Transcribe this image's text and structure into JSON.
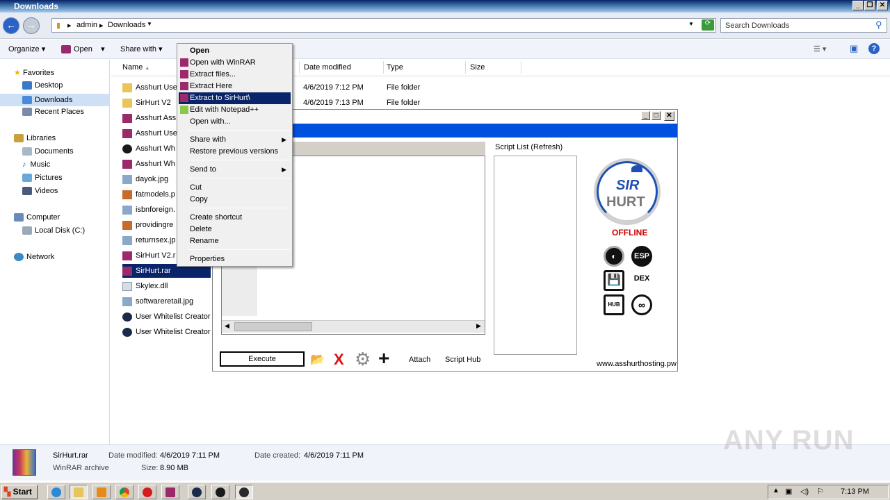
{
  "window": {
    "title": "Downloads"
  },
  "address": {
    "crumbs": [
      "admin",
      "Downloads"
    ],
    "search_placeholder": "Search Downloads"
  },
  "toolbar": {
    "organize": "Organize",
    "open": "Open",
    "share_with": "Share with"
  },
  "nav": {
    "favorites": "Favorites",
    "desktop": "Desktop",
    "downloads": "Downloads",
    "recent": "Recent Places",
    "libraries": "Libraries",
    "documents": "Documents",
    "music": "Music",
    "pictures": "Pictures",
    "videos": "Videos",
    "computer": "Computer",
    "local_disk": "Local Disk (C:)",
    "network": "Network"
  },
  "columns": {
    "name": "Name",
    "date": "Date modified",
    "type": "Type",
    "size": "Size"
  },
  "files": [
    {
      "name": "Asshurt Use",
      "date": "4/6/2019 7:12 PM",
      "type": "File folder"
    },
    {
      "name": "SirHurt V2",
      "date": "4/6/2019 7:13 PM",
      "type": "File folder"
    },
    {
      "name": "Asshurt Ass",
      "date": "",
      "type": ""
    },
    {
      "name": "Asshurt Use",
      "date": "",
      "type": ""
    },
    {
      "name": "Asshurt Wh",
      "date": "",
      "type": ""
    },
    {
      "name": "Asshurt Wh",
      "date": "",
      "type": ""
    },
    {
      "name": "dayok.jpg",
      "date": "",
      "type": ""
    },
    {
      "name": "fatmodels.p",
      "date": "",
      "type": ""
    },
    {
      "name": "isbnforeign.",
      "date": "",
      "type": ""
    },
    {
      "name": "providingre",
      "date": "",
      "type": ""
    },
    {
      "name": "returnsex.jp",
      "date": "",
      "type": ""
    },
    {
      "name": "SirHurt V2.r",
      "date": "",
      "type": ""
    },
    {
      "name": "SirHurt.rar",
      "date": "",
      "type": ""
    },
    {
      "name": "Skylex.dll",
      "date": "",
      "type": ""
    },
    {
      "name": "softwareretail.jpg",
      "date": "",
      "type": ""
    },
    {
      "name": "User Whitelist Creator",
      "date": "",
      "type": ""
    },
    {
      "name": "User Whitelist Creator",
      "date": "",
      "type": ""
    }
  ],
  "context_menu": {
    "open": "Open",
    "open_winrar": "Open with WinRAR",
    "extract_files": "Extract files...",
    "extract_here": "Extract Here",
    "extract_to": "Extract to SirHurt\\",
    "edit_notepad": "Edit with Notepad++",
    "open_with": "Open with...",
    "share_with": "Share with",
    "restore": "Restore previous versions",
    "send_to": "Send to",
    "cut": "Cut",
    "copy": "Copy",
    "create_shortcut": "Create shortcut",
    "delete": "Delete",
    "rename": "Rename",
    "properties": "Properties"
  },
  "sirhurt": {
    "script_list": "Script List (Refresh)",
    "status": "OFFLINE",
    "logo_top": "SIR",
    "logo_bottom": "HURT",
    "execute": "Execute",
    "attach": "Attach",
    "script_hub": "Script Hub",
    "website": "www.asshurthosting.pw",
    "esp": "ESP",
    "dex": "DEX",
    "hub": "HUB",
    "status_color": "#cc0000",
    "accent": "#0050e0"
  },
  "status": {
    "filename": "SirHurt.rar",
    "filetype": "WinRAR archive",
    "date_modified_label": "Date modified:",
    "date_modified": "4/6/2019 7:11 PM",
    "date_created_label": "Date created:",
    "date_created": "4/6/2019 7:11 PM",
    "size_label": "Size:",
    "size": "8.90 MB"
  },
  "taskbar": {
    "start": "Start",
    "clock": "7:13 PM"
  },
  "watermark": "ANY RUN"
}
